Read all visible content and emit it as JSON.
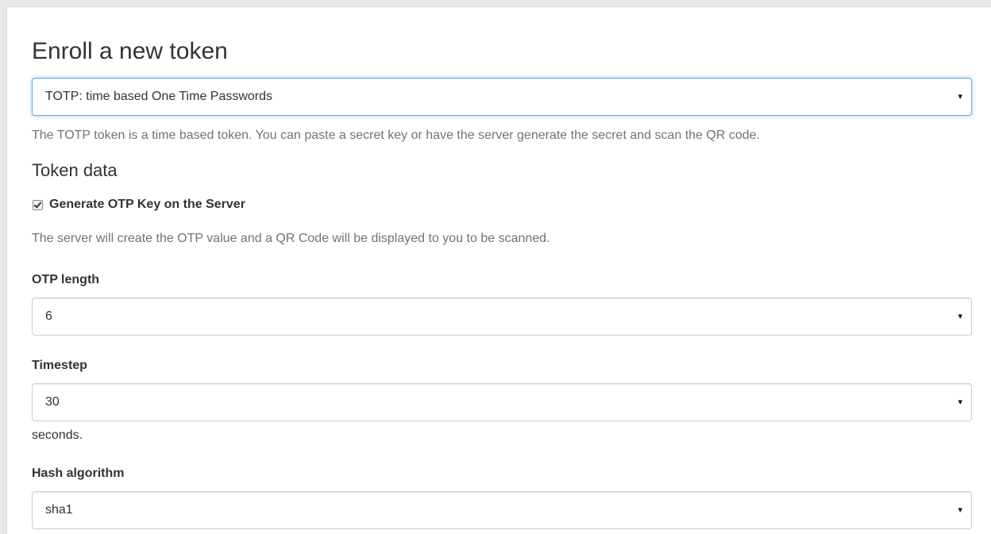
{
  "page": {
    "title": "Enroll a new token"
  },
  "token_type": {
    "selected": "TOTP: time based One Time Passwords",
    "description": "The TOTP token is a time based token. You can paste a secret key or have the server generate the secret and scan the QR code."
  },
  "token_data": {
    "heading": "Token data",
    "generate_checkbox": {
      "label": "Generate OTP Key on the Server",
      "checked": true
    },
    "generate_help": "The server will create the OTP value and a QR Code will be displayed to you to be scanned."
  },
  "otp_length": {
    "label": "OTP length",
    "selected": "6"
  },
  "timestep": {
    "label": "Timestep",
    "selected": "30",
    "unit": "seconds."
  },
  "hash_algorithm": {
    "label": "Hash algorithm",
    "selected": "sha1"
  },
  "icons": {
    "caret": "▾"
  }
}
